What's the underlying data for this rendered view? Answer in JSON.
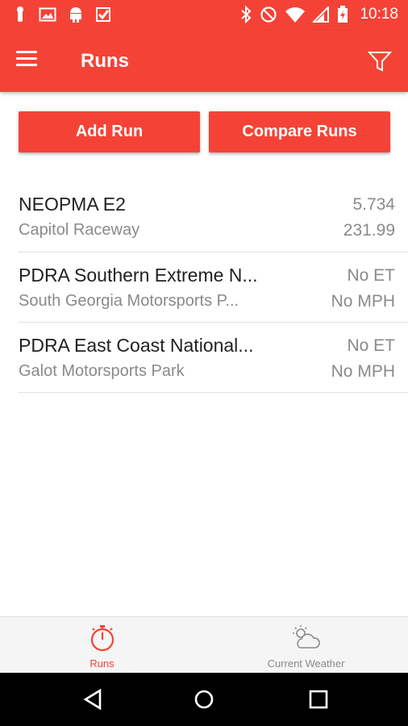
{
  "status_bar": {
    "time": "10:18",
    "left_icons": [
      "touch-icon",
      "image-icon",
      "android-icon",
      "check-app-icon"
    ],
    "right_icons": [
      "bluetooth-icon",
      "do-not-disturb-icon",
      "wifi-icon",
      "signal-icon",
      "battery-charging-icon"
    ]
  },
  "app_bar": {
    "title": "Runs",
    "menu_icon": "hamburger-menu-icon",
    "filter_icon": "filter-icon"
  },
  "actions": {
    "add_run_label": "Add Run",
    "compare_runs_label": "Compare Runs"
  },
  "runs": [
    {
      "name": "NEOPMA E2",
      "track": "Capitol Raceway",
      "et": "5.734",
      "mph": "231.99"
    },
    {
      "name": "PDRA Southern Extreme N...",
      "track": "South Georgia Motorsports P...",
      "et": "No ET",
      "mph": "No MPH"
    },
    {
      "name": "PDRA East Coast National...",
      "track": "Galot Motorsports Park",
      "et": "No ET",
      "mph": "No MPH"
    }
  ],
  "bottom_nav": {
    "items": [
      {
        "label": "Runs",
        "icon": "stopwatch-icon",
        "active": true
      },
      {
        "label": "Current Weather",
        "icon": "partly-cloudy-icon",
        "active": false
      }
    ]
  },
  "system_nav": {
    "icons": [
      "back-icon",
      "home-icon",
      "recent-apps-icon"
    ]
  },
  "colors": {
    "accent": "#f44336",
    "primary_text": "#212121",
    "secondary_text": "#8a8a8a"
  }
}
